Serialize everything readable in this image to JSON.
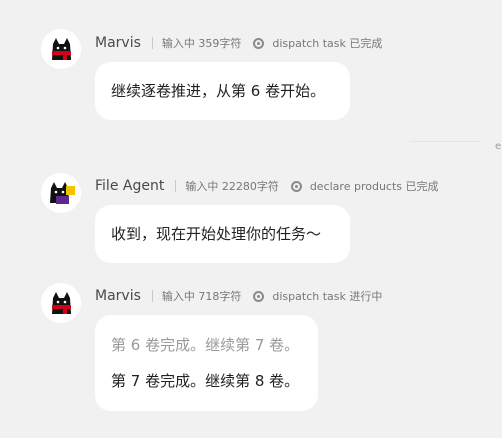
{
  "messages": [
    {
      "name": "Marvis",
      "meta": "输入中 359字符",
      "status": "dispatch task 已完成",
      "avatar_icon": "marvis-cat-icon",
      "lines": [
        "继续逐卷推进，从第 6 卷开始。"
      ]
    },
    {
      "name": "File Agent",
      "meta": "输入中 22280字符",
      "status": "declare products 已完成",
      "avatar_icon": "file-agent-cat-icon",
      "lines": [
        "收到，现在开始处理你的任务～"
      ]
    },
    {
      "name": "Marvis",
      "meta": "输入中 718字符",
      "status": "dispatch task 进行中",
      "avatar_icon": "marvis-cat-icon",
      "lines": [
        "第 6 卷完成。继续第 7 卷。",
        "第 7 卷完成。继续第 8 卷。"
      ]
    }
  ],
  "edge_text": "e",
  "colors": {
    "background": "#f1f1f2",
    "bubble": "#ffffff",
    "cat_black": "#111111",
    "scarf_red": "#d0021b",
    "file_agent_purple": "#5b2a8c",
    "file_agent_yellow": "#f5c400"
  }
}
